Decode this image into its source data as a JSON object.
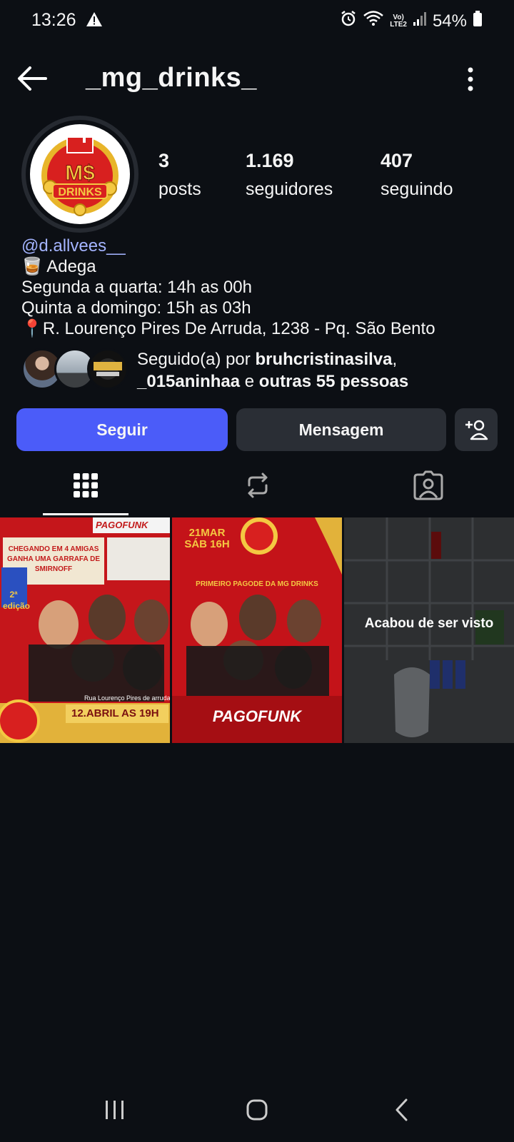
{
  "status_bar": {
    "time": "13:26",
    "battery": "54%",
    "network": "LTE2",
    "volte": "Vo)"
  },
  "header": {
    "username": "_mg_drinks_"
  },
  "avatar": {
    "logo_top": "M$",
    "logo_bottom": "DRINKS"
  },
  "stats": {
    "posts_count": "3",
    "posts_label": "posts",
    "followers_count": "1.169",
    "followers_label": "seguidores",
    "following_count": "407",
    "following_label": "seguindo"
  },
  "bio": {
    "link": "@d.allvees__",
    "line1": "🥃 Adega",
    "line2": "Segunda a quarta: 14h as 00h",
    "line3": "Quinta a domingo: 15h as 03h",
    "line4": "📍R. Lourenço Pires De Arruda, 1238 - Pq. São Bento"
  },
  "followed_by": {
    "prefix": "Seguido(a) por ",
    "user1": "bruhcristinasilva",
    "comma": ",",
    "user2": "_015aninhaa",
    "connector": " e ",
    "others": "outras 55 pessoas"
  },
  "buttons": {
    "follow": "Seguir",
    "message": "Mensagem"
  },
  "posts": [
    {
      "top_text": "CHEGANDO EM 4 AMIGAS GANHA UMA GARRAFA DE SMIRNOFF",
      "brand": "PAGOFUNK",
      "edition": "2ª edição",
      "address": "Rua Lourenço Pires de arruda 123",
      "date": "12.ABRIL AS 19H"
    },
    {
      "date": "21MAR SÁB 16H",
      "headline": "PRIMEIRO PAGODE DA MG DRINKS",
      "brand": "PAGOFUNK"
    },
    {
      "overlay": "Acabou de ser visto"
    }
  ],
  "colors": {
    "background": "#0c0f14",
    "follow_button": "#4b5cf9",
    "secondary_button": "#2a2e35",
    "link": "#a4b4ff"
  }
}
